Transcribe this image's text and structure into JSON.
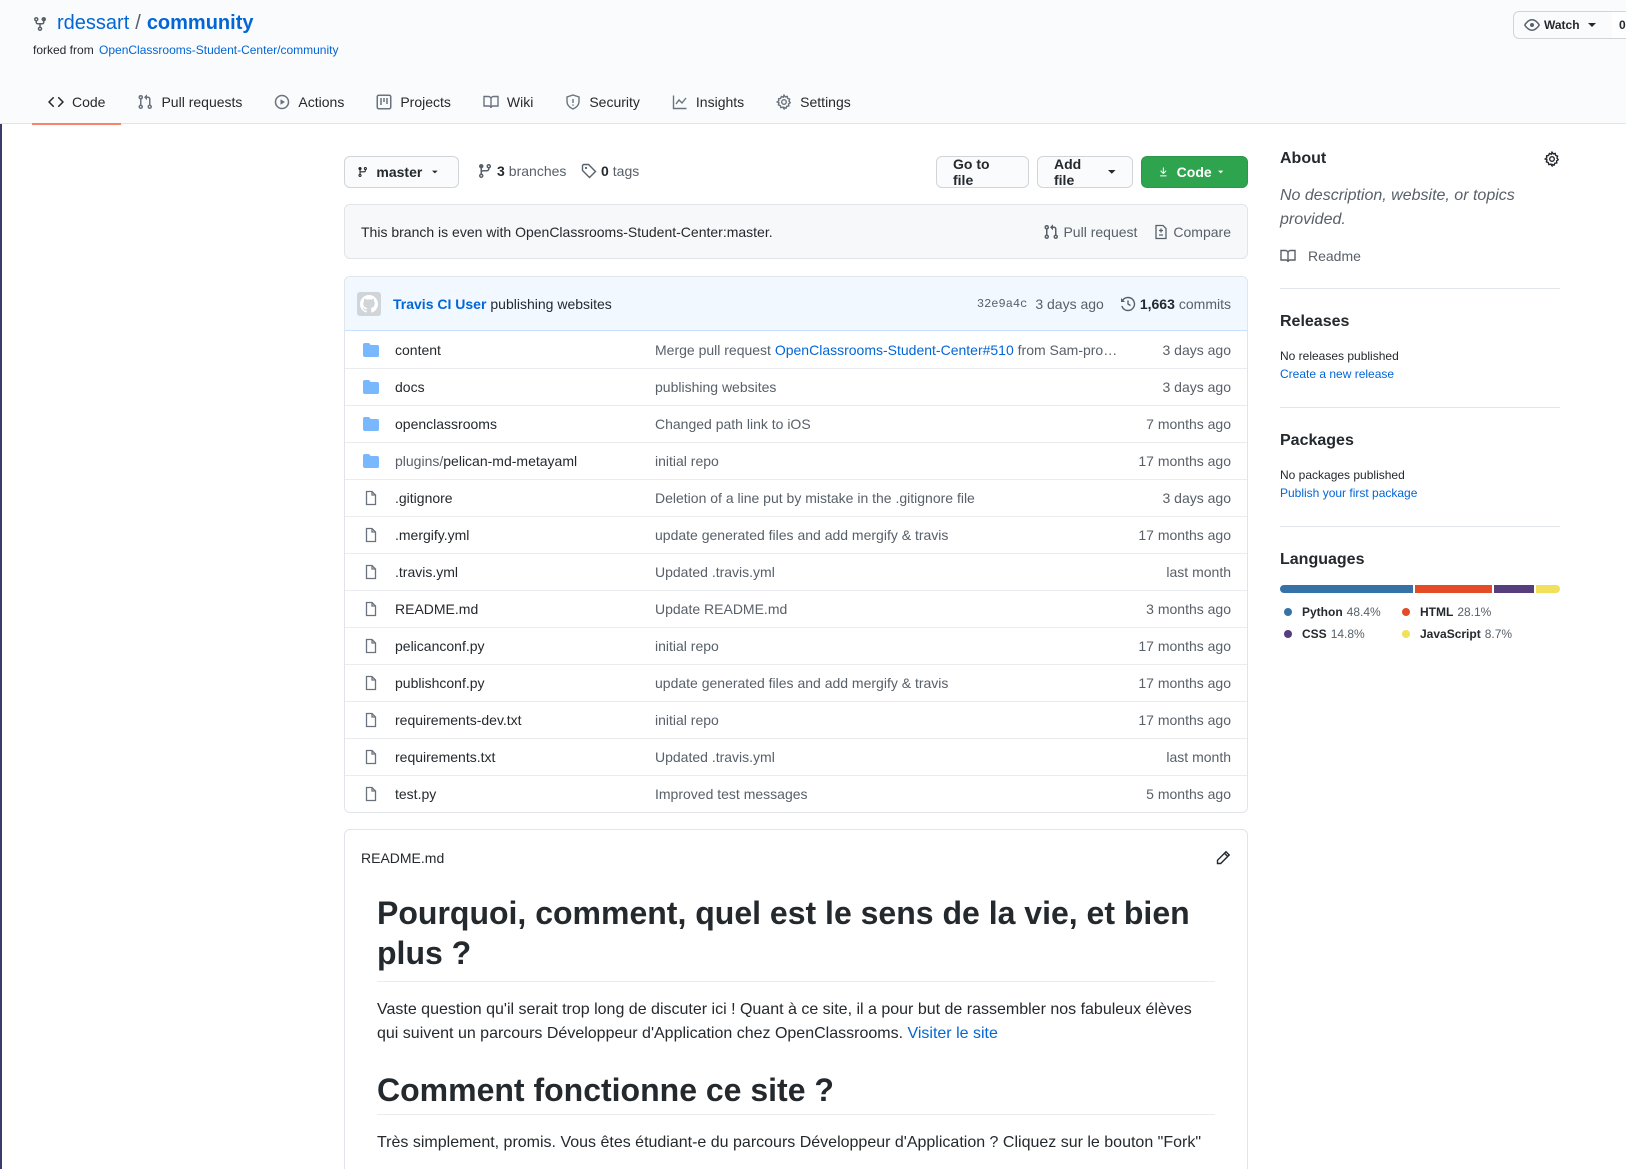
{
  "repo": {
    "owner": "rdessart",
    "separator": "/",
    "name": "community",
    "forked_prefix": "forked from",
    "forked_source": "OpenClassrooms-Student-Center/community"
  },
  "watch": {
    "label": "Watch",
    "count": "0"
  },
  "tabs": [
    {
      "label": "Code",
      "icon": "code-icon"
    },
    {
      "label": "Pull requests",
      "icon": "pull-request-icon"
    },
    {
      "label": "Actions",
      "icon": "play-icon"
    },
    {
      "label": "Projects",
      "icon": "project-icon"
    },
    {
      "label": "Wiki",
      "icon": "book-icon"
    },
    {
      "label": "Security",
      "icon": "shield-icon"
    },
    {
      "label": "Insights",
      "icon": "graph-icon"
    },
    {
      "label": "Settings",
      "icon": "gear-icon"
    }
  ],
  "toolbar": {
    "branch": "master",
    "branches_count": "3",
    "branches_label": "branches",
    "tags_count": "0",
    "tags_label": "tags",
    "goto_file": "Go to file",
    "add_file": "Add file",
    "code": "Code"
  },
  "branch_info": {
    "text": "This branch is even with OpenClassrooms-Student-Center:master.",
    "pull_request": "Pull request",
    "compare": "Compare"
  },
  "latest_commit": {
    "author": "Travis CI User",
    "message": "publishing websites",
    "sha": "32e9a4c",
    "age": "3 days ago",
    "count": "1,663",
    "count_label": "commits"
  },
  "files": [
    {
      "type": "dir",
      "name": "content",
      "msg_prefix": "Merge pull request ",
      "msg_link": "OpenClassrooms-Student-Center#510",
      "msg_suffix": " from Sam-pro…",
      "age": "3 days ago"
    },
    {
      "type": "dir",
      "name": "docs",
      "msg_prefix": "publishing websites",
      "msg_link": "",
      "msg_suffix": "",
      "age": "3 days ago"
    },
    {
      "type": "dir",
      "name": "openclassrooms",
      "msg_prefix": "Changed path link to iOS",
      "msg_link": "",
      "msg_suffix": "",
      "age": "7 months ago"
    },
    {
      "type": "dir",
      "name_dim": "plugins/",
      "name": "pelican-md-metayaml",
      "msg_prefix": "initial repo",
      "msg_link": "",
      "msg_suffix": "",
      "age": "17 months ago"
    },
    {
      "type": "file",
      "name": ".gitignore",
      "msg_prefix": "Deletion of a line put by mistake in the .gitignore file",
      "msg_link": "",
      "msg_suffix": "",
      "age": "3 days ago"
    },
    {
      "type": "file",
      "name": ".mergify.yml",
      "msg_prefix": "update generated files and add mergify & travis",
      "msg_link": "",
      "msg_suffix": "",
      "age": "17 months ago"
    },
    {
      "type": "file",
      "name": ".travis.yml",
      "msg_prefix": "Updated .travis.yml",
      "msg_link": "",
      "msg_suffix": "",
      "age": "last month"
    },
    {
      "type": "file",
      "name": "README.md",
      "msg_prefix": "Update README.md",
      "msg_link": "",
      "msg_suffix": "",
      "age": "3 months ago"
    },
    {
      "type": "file",
      "name": "pelicanconf.py",
      "msg_prefix": "initial repo",
      "msg_link": "",
      "msg_suffix": "",
      "age": "17 months ago"
    },
    {
      "type": "file",
      "name": "publishconf.py",
      "msg_prefix": "update generated files and add mergify & travis",
      "msg_link": "",
      "msg_suffix": "",
      "age": "17 months ago"
    },
    {
      "type": "file",
      "name": "requirements-dev.txt",
      "msg_prefix": "initial repo",
      "msg_link": "",
      "msg_suffix": "",
      "age": "17 months ago"
    },
    {
      "type": "file",
      "name": "requirements.txt",
      "msg_prefix": "Updated .travis.yml",
      "msg_link": "",
      "msg_suffix": "",
      "age": "last month"
    },
    {
      "type": "file",
      "name": "test.py",
      "msg_prefix": "Improved test messages",
      "msg_link": "",
      "msg_suffix": "",
      "age": "5 months ago"
    }
  ],
  "readme": {
    "filename": "README.md",
    "h1": "Pourquoi, comment, quel est le sens de la vie, et bien plus ?",
    "p1": "Vaste question qu'il serait trop long de discuter ici ! Quant à ce site, il a pour but de rassembler nos fabuleux élèves qui suivent un parcours Développeur d'Application chez OpenClassrooms. ",
    "p1_link": "Visiter le site",
    "h2": "Comment fonctionne ce site ?",
    "p2": "Très simplement, promis. Vous êtes étudiant-e du parcours Développeur d'Application ? Cliquez sur le bouton \"Fork\""
  },
  "sidebar": {
    "about_title": "About",
    "about_desc": "No description, website, or topics provided.",
    "readme_label": "Readme",
    "releases_title": "Releases",
    "releases_none": "No releases published",
    "releases_link": "Create a new release",
    "packages_title": "Packages",
    "packages_none": "No packages published",
    "packages_link": "Publish your first package",
    "languages_title": "Languages",
    "languages": [
      {
        "name": "Python",
        "pct": "48.4%",
        "value": 48.4,
        "color": "#3572A5"
      },
      {
        "name": "HTML",
        "pct": "28.1%",
        "value": 28.1,
        "color": "#e34c26"
      },
      {
        "name": "CSS",
        "pct": "14.8%",
        "value": 14.8,
        "color": "#563d7c"
      },
      {
        "name": "JavaScript",
        "pct": "8.7%",
        "value": 8.7,
        "color": "#f1e05a"
      }
    ]
  }
}
